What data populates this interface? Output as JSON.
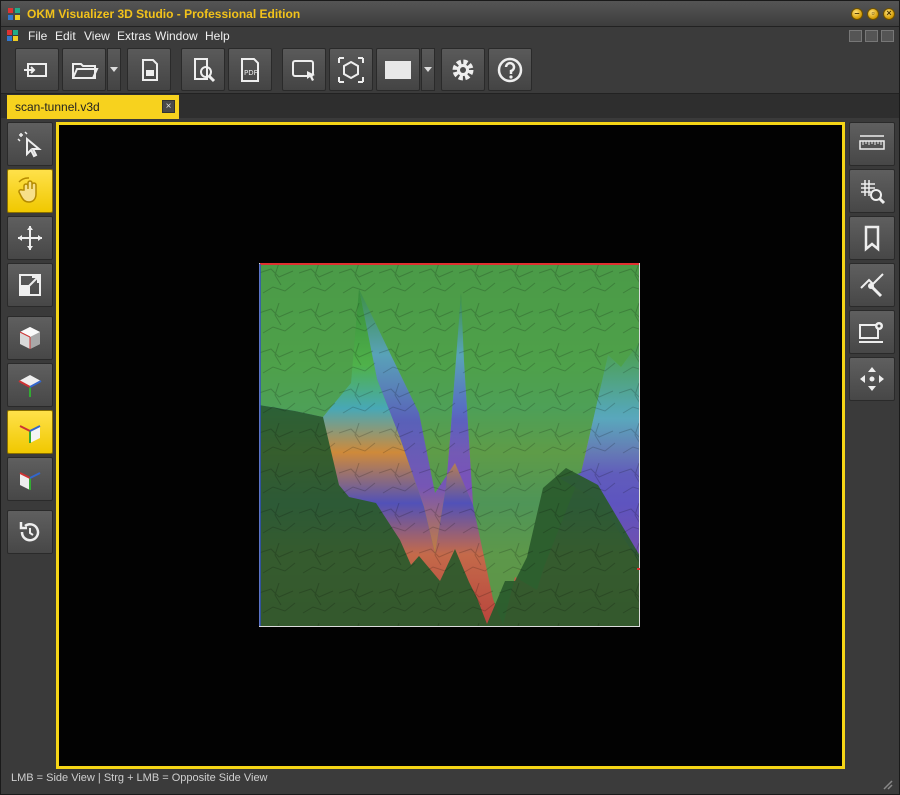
{
  "window": {
    "title": "OKM Visualizer 3D Studio - Professional Edition"
  },
  "menubar": {
    "items": [
      "File",
      "Edit",
      "View",
      "Extras",
      "Window",
      "Help"
    ]
  },
  "toolbar": {
    "buttons": [
      {
        "name": "device-transfer-icon"
      },
      {
        "name": "open-folder-icon"
      },
      {
        "name": "sd-card-icon"
      },
      {
        "name": "document-search-icon"
      },
      {
        "name": "pdf-export-icon"
      },
      {
        "name": "screen-capture-icon"
      },
      {
        "name": "3d-cube-view-icon"
      },
      {
        "name": "color-swatch-icon"
      },
      {
        "name": "settings-gear-icon"
      },
      {
        "name": "help-icon"
      }
    ]
  },
  "tabs": [
    {
      "label": "scan-tunnel.v3d",
      "close": "×",
      "active": true
    }
  ],
  "left_toolbox": [
    {
      "name": "select-pointer-icon",
      "active": false
    },
    {
      "name": "rotate-hand-icon",
      "active": true
    },
    {
      "name": "move-arrows-icon",
      "active": false
    },
    {
      "name": "scale-icon",
      "active": false
    },
    {
      "name": "perspective-view-icon",
      "active": false
    },
    {
      "name": "top-view-icon",
      "active": false
    },
    {
      "name": "side-view-icon",
      "active": true
    },
    {
      "name": "front-view-icon",
      "active": false
    },
    {
      "name": "reset-rotation-icon",
      "active": false
    }
  ],
  "right_toolbox": [
    {
      "name": "ruler-icon"
    },
    {
      "name": "grid-zoom-icon"
    },
    {
      "name": "bookmark-icon"
    },
    {
      "name": "probe-measure-icon"
    },
    {
      "name": "display-settings-icon"
    },
    {
      "name": "navigate-cross-icon"
    }
  ],
  "statusbar": {
    "text": "LMB = Side View  |  Strg + LMB = Opposite Side View"
  },
  "colors": {
    "accent": "#f5d516",
    "title_text": "#f2c21b",
    "viewport_bg": "#020202"
  }
}
